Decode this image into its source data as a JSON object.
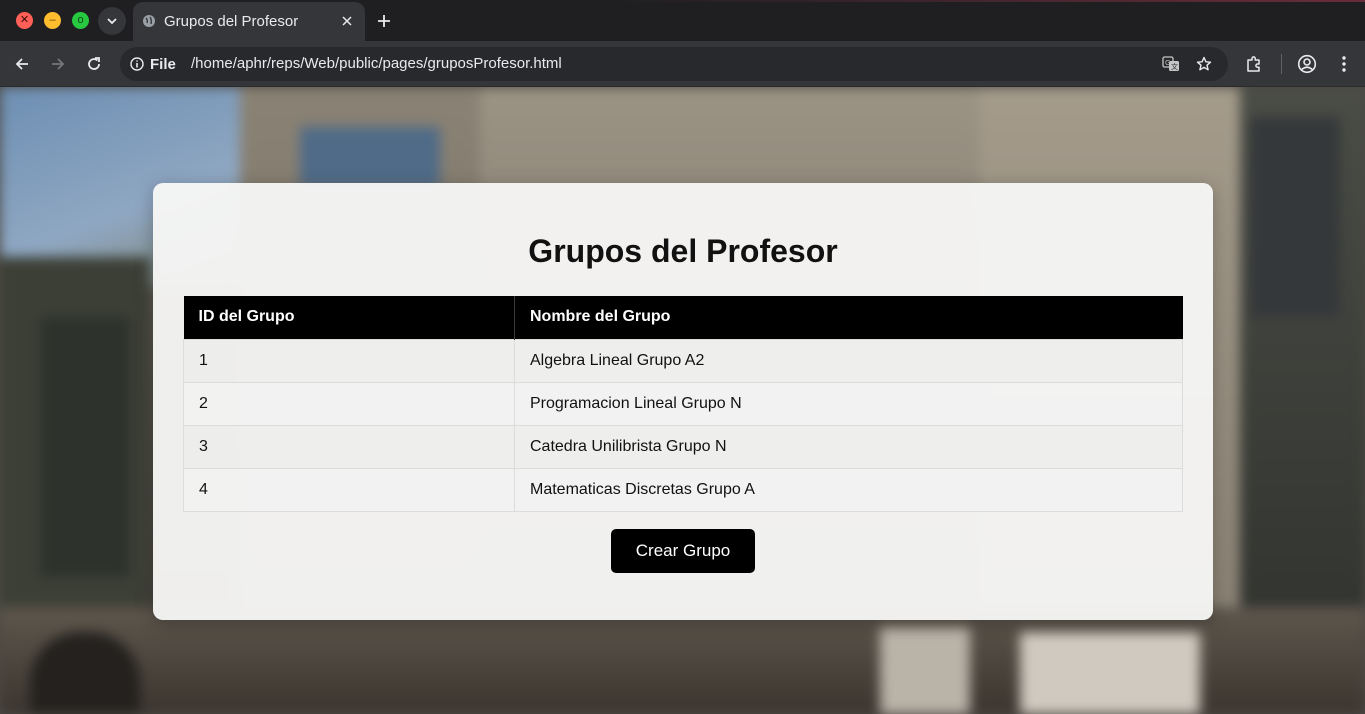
{
  "browser": {
    "tab": {
      "title": "Grupos del Profesor"
    },
    "window_controls": {
      "close": "✕",
      "minimize": "–",
      "maximize": "o"
    },
    "address_bar": {
      "site_chip": "File",
      "url": "/home/aphr/reps/Web/public/pages/gruposProfesor.html"
    },
    "icons": [
      "tab-search-icon",
      "globe-icon",
      "close-icon",
      "plus-icon",
      "back-arrow-icon",
      "forward-arrow-icon",
      "reload-icon",
      "info-icon",
      "translate-icon",
      "star-icon",
      "extensions-icon",
      "profile-icon",
      "menu-dots-icon"
    ]
  },
  "page": {
    "title": "Grupos del Profesor",
    "table": {
      "headers": [
        "ID del Grupo",
        "Nombre del Grupo"
      ],
      "rows": [
        [
          "1",
          "Algebra Lineal Grupo A2"
        ],
        [
          "2",
          "Programacion Lineal Grupo N"
        ],
        [
          "3",
          "Catedra Unilibrista Grupo N"
        ],
        [
          "4",
          "Matematicas Discretas Grupo A"
        ]
      ]
    },
    "create_button": "Crear Grupo"
  },
  "colors": {
    "chrome_dark": "#1f1f22",
    "toolbar": "#35363a",
    "omnibox": "#28292c",
    "table_header": "#000000",
    "button": "#000000"
  }
}
